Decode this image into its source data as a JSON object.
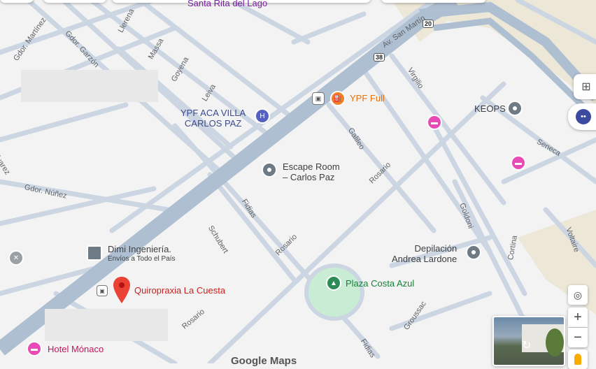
{
  "map": {
    "streets": {
      "gdor_martinez": "Gdor. Martínez",
      "gdor_garzon": "Gdor. Garzón",
      "llerena": "Llerena",
      "massa": "Massa",
      "goyena": "Goyena",
      "leiva": "Leiva",
      "av_san_martin": "Av. San Martín",
      "virgilio": "Virgilio",
      "galileo": "Galileo",
      "seneca": "Seneca",
      "alvarez": "Alvarez",
      "gdor_nunez": "Gdor. Núñez",
      "fidias_top": "Fidias",
      "schubert": "Schubert",
      "rosario_mid": "Rosario",
      "rosario_low": "Rosario",
      "rosario_bottom": "Rosario",
      "goldoni": "Goldoni",
      "voltaire": "Voltaire",
      "cortina": "Cortina",
      "groussac": "Groussac",
      "fidias_bottom": "Fidias",
      "top_partial": "Santa Rita del Lago"
    },
    "shields": {
      "route_20": "20",
      "route_38": "38"
    },
    "pois": {
      "ypf_full": "YPF Full",
      "ypf_aca": "YPF ACA VILLA\nCARLOS PAZ",
      "keops": "KEOPS",
      "escape_room": "Escape Room\n– Carlos Paz",
      "dimi": "Dimi Ingeniería.",
      "dimi_sub": "Envíos a Todo el País",
      "quiropraxia": "Quiropraxia La Cuesta",
      "plaza": "Plaza Costa Azul",
      "depilacion": "Depilación\nAndrea Lardone",
      "hotel": "Hotel Mónaco"
    },
    "attribution": "Google Maps"
  },
  "colors": {
    "land": "#f3f3f3",
    "street": "#ccd6e2",
    "avenue": "#aebfd1",
    "park": "#c9ecd5",
    "sand": "#ece7d6"
  },
  "controls": {
    "zoom_in": "+",
    "zoom_out": "−"
  }
}
